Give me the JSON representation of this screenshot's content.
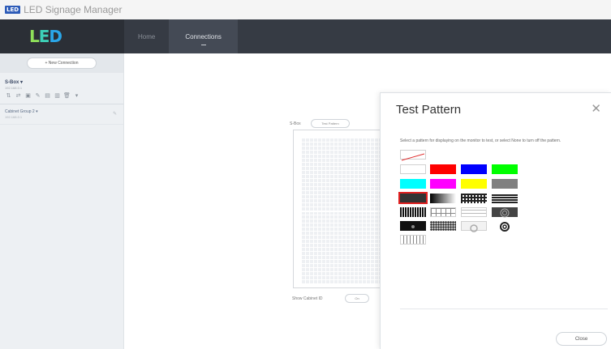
{
  "app": {
    "badge": "LED",
    "title": "LED Signage Manager"
  },
  "header": {
    "logo": {
      "l1": "L",
      "l2": "E",
      "l3": "D"
    },
    "nav": [
      {
        "label": "Home"
      },
      {
        "label": "Connections"
      }
    ]
  },
  "sidebar": {
    "new_connection_label": "+  New Connection",
    "sbox": {
      "name": "S-Box ▾",
      "sub": "192.168.0.1"
    },
    "tools": [
      "⇅",
      "⇄",
      "▣",
      "✎",
      "▤",
      "▥",
      "🗑",
      "▾"
    ],
    "cabinet_group": {
      "name": "Cabinet Group 2 ▾",
      "sub": "192.168.0.1",
      "edit": "✎"
    }
  },
  "main": {
    "sbox_label": "S-Box",
    "test_pattern_chip": "Test Pattern",
    "show_cabinet_id_label": "Show Cabinet ID",
    "toggle_label": "On"
  },
  "dialog": {
    "title": "Test Pattern",
    "close_icon": "✕",
    "description": "Select a pattern for displaying on the monitor to test, or select None to turn off the pattern.",
    "close_button": "Close",
    "patterns": [
      {
        "name": "none",
        "selected": false
      },
      {
        "name": "white",
        "color": "#ffffff",
        "selected": false
      },
      {
        "name": "red",
        "color": "#ff0000",
        "selected": false
      },
      {
        "name": "blue",
        "color": "#0000ff",
        "selected": false
      },
      {
        "name": "green",
        "color": "#00ff00",
        "selected": false
      },
      {
        "name": "cyan",
        "color": "#00ffff",
        "selected": false
      },
      {
        "name": "magenta",
        "color": "#ff00ff",
        "selected": false
      },
      {
        "name": "yellow",
        "color": "#ffff00",
        "selected": false
      },
      {
        "name": "gray",
        "color": "#808080",
        "selected": false
      },
      {
        "name": "dark-gray",
        "color": "#333333",
        "selected": true
      },
      {
        "name": "gradient",
        "selected": false
      },
      {
        "name": "checker",
        "selected": false
      },
      {
        "name": "horizontal-lines",
        "selected": false
      },
      {
        "name": "vertical-lines",
        "selected": false
      },
      {
        "name": "grid",
        "selected": false
      },
      {
        "name": "horizontal-stripes-light",
        "selected": false
      },
      {
        "name": "circles-dark",
        "selected": false
      },
      {
        "name": "dot-black",
        "selected": false
      },
      {
        "name": "dot-grid",
        "selected": false
      },
      {
        "name": "circle-light",
        "selected": false
      },
      {
        "name": "circles-bold",
        "selected": false
      },
      {
        "name": "vertical-lines-light",
        "selected": false
      }
    ],
    "selection_color": "#e02020"
  }
}
